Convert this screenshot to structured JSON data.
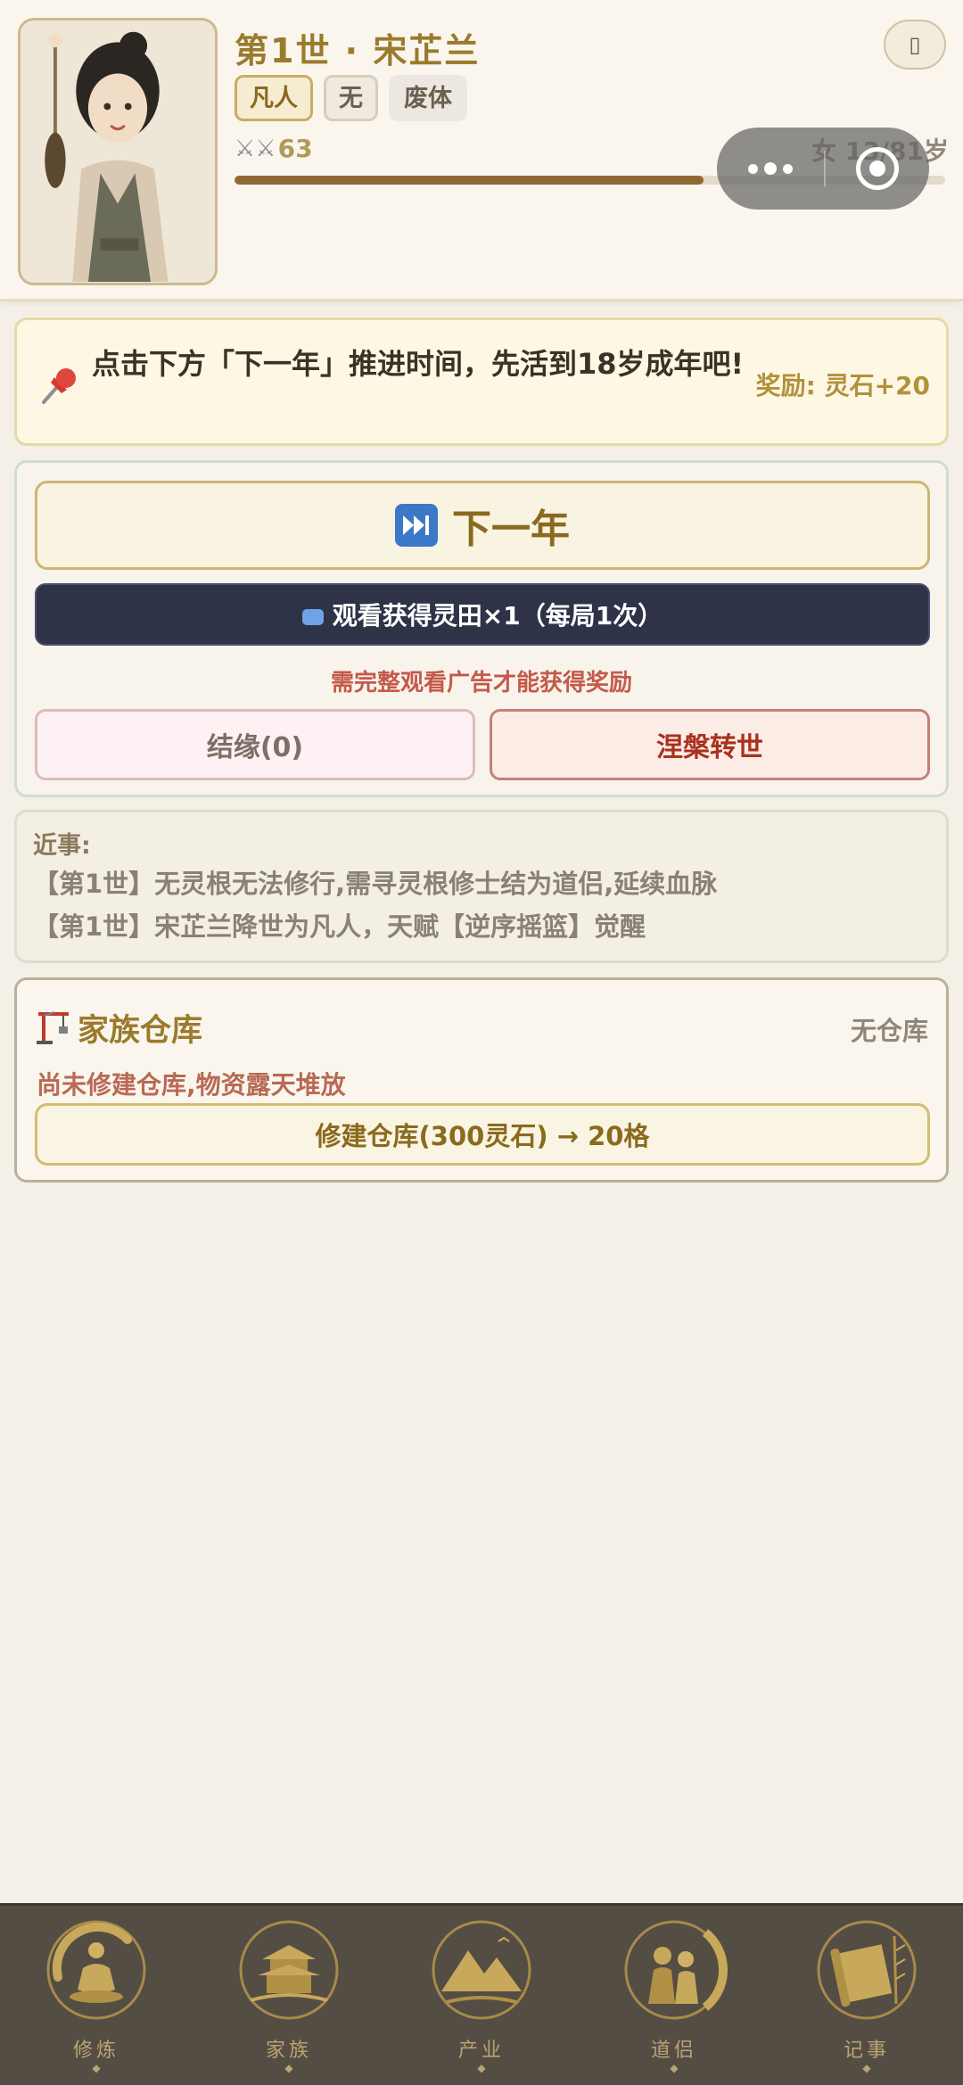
{
  "header": {
    "title": "第1世 · 宋芷兰",
    "tags": {
      "realm": "凡人",
      "root": "无",
      "body": "废体"
    },
    "combat_power": "63",
    "age_label": "女 13/81岁",
    "lifespan_progress": 0.66,
    "side_button_glyph": "▯"
  },
  "task": {
    "text": "点击下方「下一年」推进时间，先活到18岁成年吧!",
    "reward": "奖励: 灵石+20"
  },
  "actions": {
    "next_year_label": "下一年",
    "ad_button_label": "观看获得灵田×1（每局1次）",
    "ad_note": "需完整观看广告才能获得奖励",
    "bond_label": "结缘(0)",
    "reincarnate_label": "涅槃转世"
  },
  "events": {
    "title": "近事:",
    "items": [
      "【第1世】无灵根无法修行,需寻灵根修士结为道侣,延续血脉",
      "【第1世】宋芷兰降世为凡人，天赋【逆序摇篮】觉醒"
    ]
  },
  "warehouse": {
    "title": "家族仓库",
    "status": "无仓库",
    "description": "尚未修建仓库,物资露天堆放",
    "build_label": "修建仓库(300灵石) → 20格"
  },
  "nav": {
    "items": [
      {
        "label": "修炼",
        "icon": "meditation-icon"
      },
      {
        "label": "家族",
        "icon": "pavilion-icon"
      },
      {
        "label": "产业",
        "icon": "mountain-icon"
      },
      {
        "label": "道侣",
        "icon": "couple-icon"
      },
      {
        "label": "记事",
        "icon": "scroll-icon"
      }
    ]
  },
  "colors": {
    "gold": "#9a7a2c",
    "ad_button_bg": "#2e3348",
    "reincarnate_text": "#a8321f",
    "nav_bg": "#544d43"
  }
}
